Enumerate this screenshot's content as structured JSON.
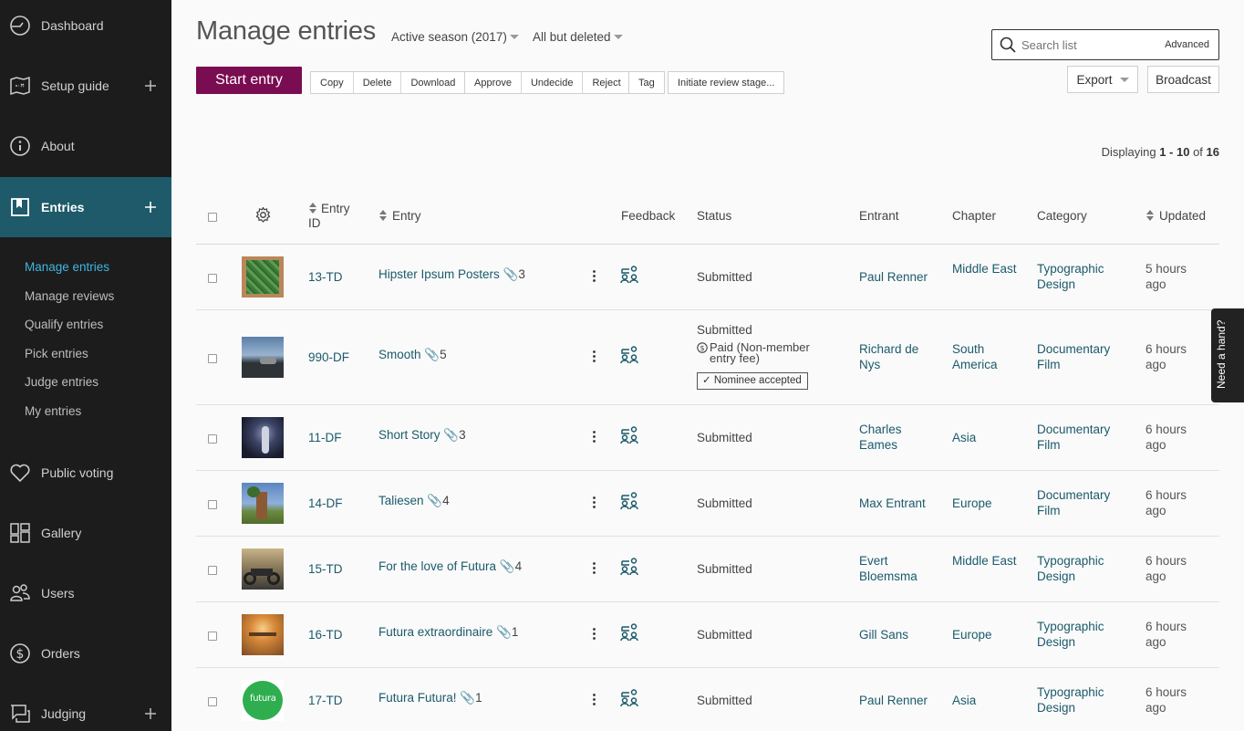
{
  "sidebar": {
    "items": [
      {
        "label": "Dashboard",
        "icon": "dashboard-icon"
      },
      {
        "label": "Setup guide",
        "icon": "map-icon",
        "plus": true
      },
      {
        "label": "About",
        "icon": "info-icon"
      },
      {
        "label": "Entries",
        "icon": "entries-icon",
        "plus": true,
        "active": true
      },
      {
        "label": "Public voting",
        "icon": "heart-icon"
      },
      {
        "label": "Gallery",
        "icon": "gallery-icon"
      },
      {
        "label": "Users",
        "icon": "users-icon"
      },
      {
        "label": "Orders",
        "icon": "dollar-icon"
      },
      {
        "label": "Judging",
        "icon": "judging-icon",
        "plus": true
      }
    ],
    "sub_items": [
      "Manage entries",
      "Manage reviews",
      "Qualify entries",
      "Pick entries",
      "Judge entries",
      "My entries"
    ]
  },
  "header": {
    "title": "Manage entries",
    "season_filter": "Active season (2017)",
    "deleted_filter": "All but deleted",
    "search_placeholder": "Search list",
    "advanced": "Advanced"
  },
  "toolbar": {
    "start": "Start entry",
    "group1": [
      "Copy",
      "Delete",
      "Download"
    ],
    "group2": [
      "Approve",
      "Undecide",
      "Reject"
    ],
    "tag": "Tag",
    "review": "Initiate review stage...",
    "export": "Export",
    "broadcast": "Broadcast"
  },
  "pagination": {
    "prefix": "Displaying",
    "range": "1 - 10",
    "of": "of",
    "total": "16"
  },
  "columns": {
    "entry_id": "Entry ID",
    "entry": "Entry",
    "feedback": "Feedback",
    "status": "Status",
    "entrant": "Entrant",
    "chapter": "Chapter",
    "category": "Category",
    "updated": "Updated"
  },
  "rows": [
    {
      "id": "13-TD",
      "title": "Hipster Ipsum Posters",
      "files": "3",
      "status": "Submitted",
      "entrant": "Paul Renner",
      "chapter": "Middle East",
      "category": "Typographic Design",
      "updated": "5 hours ago"
    },
    {
      "id": "990-DF",
      "title": "Smooth",
      "files": "5",
      "status": "Submitted",
      "payment": "Paid (Non-member entry fee)",
      "nominee": "Nominee accepted",
      "entrant": "Richard de Nys",
      "chapter": "South America",
      "category": "Documentary Film",
      "updated": "6 hours ago"
    },
    {
      "id": "11-DF",
      "title": "Short Story",
      "files": "3",
      "status": "Submitted",
      "entrant": "Charles Eames",
      "chapter": "Asia",
      "category": "Documentary Film",
      "updated": "6 hours ago"
    },
    {
      "id": "14-DF",
      "title": "Taliesen",
      "files": "4",
      "status": "Submitted",
      "entrant": "Max Entrant",
      "chapter": "Europe",
      "category": "Documentary Film",
      "updated": "6 hours ago"
    },
    {
      "id": "15-TD",
      "title": "For the love of Futura",
      "files": "4",
      "status": "Submitted",
      "entrant": "Evert Bloemsma",
      "chapter": "Middle East",
      "category": "Typographic Design",
      "updated": "6 hours ago"
    },
    {
      "id": "16-TD",
      "title": "Futura extraordinaire",
      "files": "1",
      "status": "Submitted",
      "entrant": "Gill Sans",
      "chapter": "Europe",
      "category": "Typographic Design",
      "updated": "6 hours ago"
    },
    {
      "id": "17-TD",
      "title": "Futura Futura!",
      "files": "1",
      "status": "Submitted",
      "entrant": "Paul Renner",
      "chapter": "Asia",
      "category": "Typographic Design",
      "updated": "6 hours ago"
    }
  ],
  "thumb_logo_text": "futura",
  "help_tab": "Need a hand?"
}
